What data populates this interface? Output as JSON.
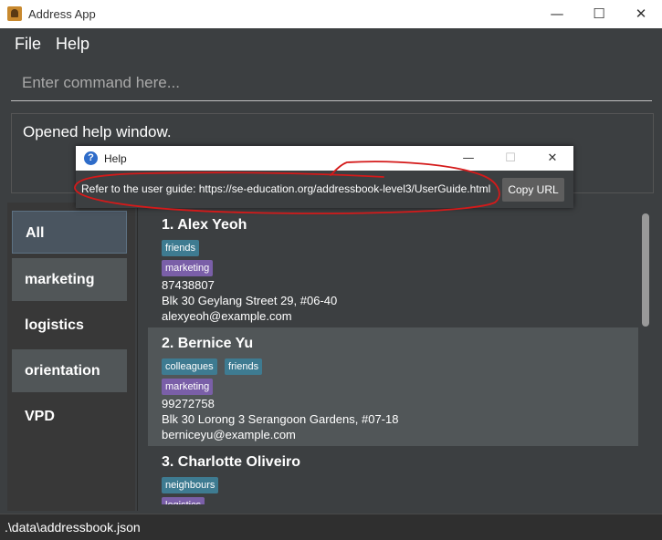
{
  "window": {
    "title": "Address App",
    "minimize": "—",
    "maximize": "☐",
    "close": "✕"
  },
  "menu": {
    "file": "File",
    "help": "Help"
  },
  "command": {
    "placeholder": "Enter command here..."
  },
  "result": {
    "text": "Opened help window."
  },
  "tag_list": [
    "All",
    "marketing",
    "logistics",
    "orientation",
    "VPD"
  ],
  "persons": [
    {
      "name": "1.  Alex Yeoh",
      "tag_rows": [
        [
          {
            "label": "friends",
            "color": "#3e7b91"
          }
        ],
        [
          {
            "label": "marketing",
            "color": "#7a5fa8"
          }
        ]
      ],
      "phone": "87438807",
      "address": "Blk 30 Geylang Street 29, #06-40",
      "email": "alexyeoh@example.com"
    },
    {
      "name": "2.  Bernice Yu",
      "tag_rows": [
        [
          {
            "label": "colleagues",
            "color": "#3e7b91"
          },
          {
            "label": "friends",
            "color": "#3e7b91"
          }
        ],
        [
          {
            "label": "marketing",
            "color": "#7a5fa8"
          }
        ]
      ],
      "phone": "99272758",
      "address": "Blk 30 Lorong 3 Serangoon Gardens, #07-18",
      "email": "berniceyu@example.com"
    },
    {
      "name": "3.  Charlotte Oliveiro",
      "tag_rows": [
        [
          {
            "label": "neighbours",
            "color": "#3e7b91"
          }
        ],
        [
          {
            "label": "logistics",
            "color": "#7a5fa8"
          }
        ]
      ],
      "phone": "",
      "address": "",
      "email": ""
    }
  ],
  "status": {
    "path": ".\\data\\addressbook.json"
  },
  "help_window": {
    "title": "Help",
    "icon": "?",
    "message": "Refer to the user guide: https://se-education.org/addressbook-level3/UserGuide.html",
    "copy_button": "Copy URL",
    "minimize": "—",
    "maximize": "☐",
    "close": "✕"
  },
  "colors": {
    "selected_tag_bg": "#4a5560",
    "card_even": "#515658",
    "card_odd": "#3c3f41",
    "annotation": "#d41a1a"
  }
}
